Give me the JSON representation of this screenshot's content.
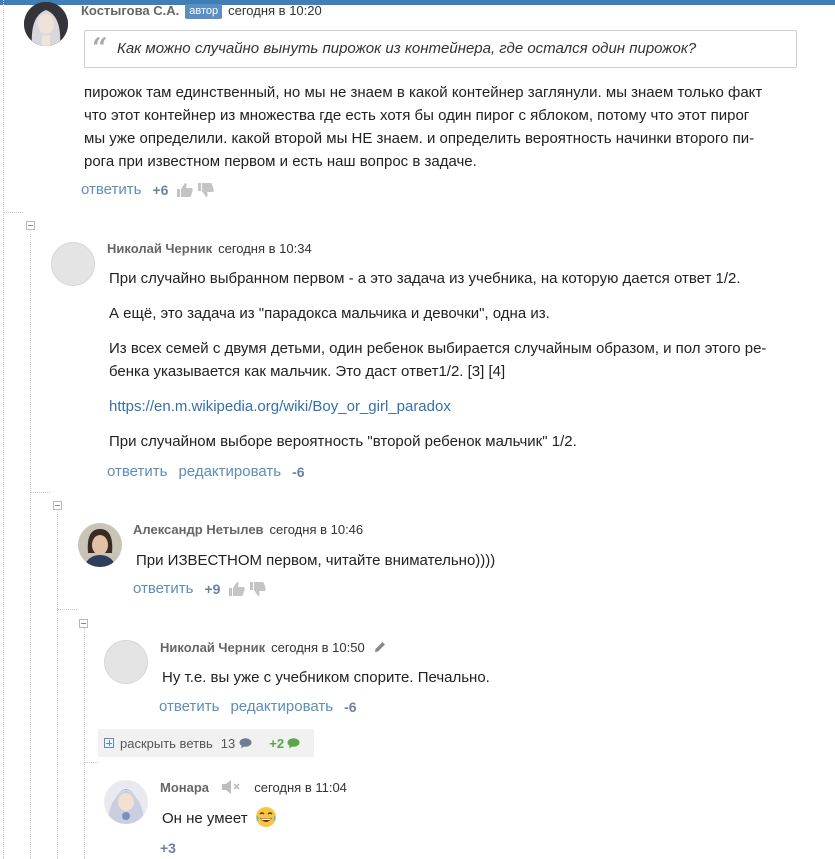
{
  "c1": {
    "author": "Костыгова С.А.",
    "badge": "автор",
    "time": "сегодня в 10:20",
    "quote": "Как можно случайно вынуть пирожок из контейнера, где остался один пирожок?",
    "lines": [
      "пирожок там единственный, но мы не знаем в какой контейнер заглянули. мы знаем только факт",
      "что этот контейнер из множества где есть хотя бы один пирог с яблоком, потому что этот пирог",
      "мы уже определили. какой второй мы НЕ знаем. и определить вероятность начинки второго пи-",
      "рога при известном первом и есть наш вопрос в задаче."
    ],
    "reply": "ответить",
    "score": "+6"
  },
  "c2": {
    "author": "Николай Черник",
    "time": "сегодня в 10:34",
    "p1": "При случайно выбранном первом - а это задача из учебника, на которую дается ответ 1/2.",
    "p2": "А ещё, это задача из \"парадокса мальчика и девочки\", одна из.",
    "p3a": "Из всех семей с двумя детьми, один ребенок выбирается случайным образом, и пол этого ре-",
    "p3b": "бенка указывается как мальчик. Это даст ответ1/2. [3] [4]",
    "link": "https://en.m.wikipedia.org/wiki/Boy_or_girl_paradox",
    "p4": "При случайном выборе вероятность \"второй ребенок мальчик\" 1/2.",
    "reply": "ответить",
    "edit": "редактировать",
    "score": "-6"
  },
  "c3": {
    "author": "Александр Нетылев",
    "time": "сегодня в 10:46",
    "text": "При ИЗВЕСТНОМ первом, читайте внимательно))))",
    "reply": "ответить",
    "score": "+9"
  },
  "c4": {
    "author": "Николай Черник",
    "time": "сегодня в 10:50",
    "text": "Ну т.е. вы уже с учебником спорите. Печально.",
    "reply": "ответить",
    "edit": "редактировать",
    "score": "-6"
  },
  "expand": {
    "label": "раскрыть ветвь",
    "count": "13",
    "new": "+2"
  },
  "c5": {
    "author": "Монара",
    "time": "сегодня в 11:04",
    "text": "Он не умеет",
    "score": "+3"
  },
  "colors": {
    "accent": "#3f7fb5",
    "link": "#5d8db8",
    "new_count": "#5aa64a"
  },
  "icons": [
    "thumb-up-icon",
    "thumb-down-icon",
    "quote-icon",
    "collapse-icon",
    "pencil-icon",
    "muted-speaker-icon",
    "comment-bubble-icon",
    "expand-icon",
    "laughing-emoji-icon"
  ]
}
